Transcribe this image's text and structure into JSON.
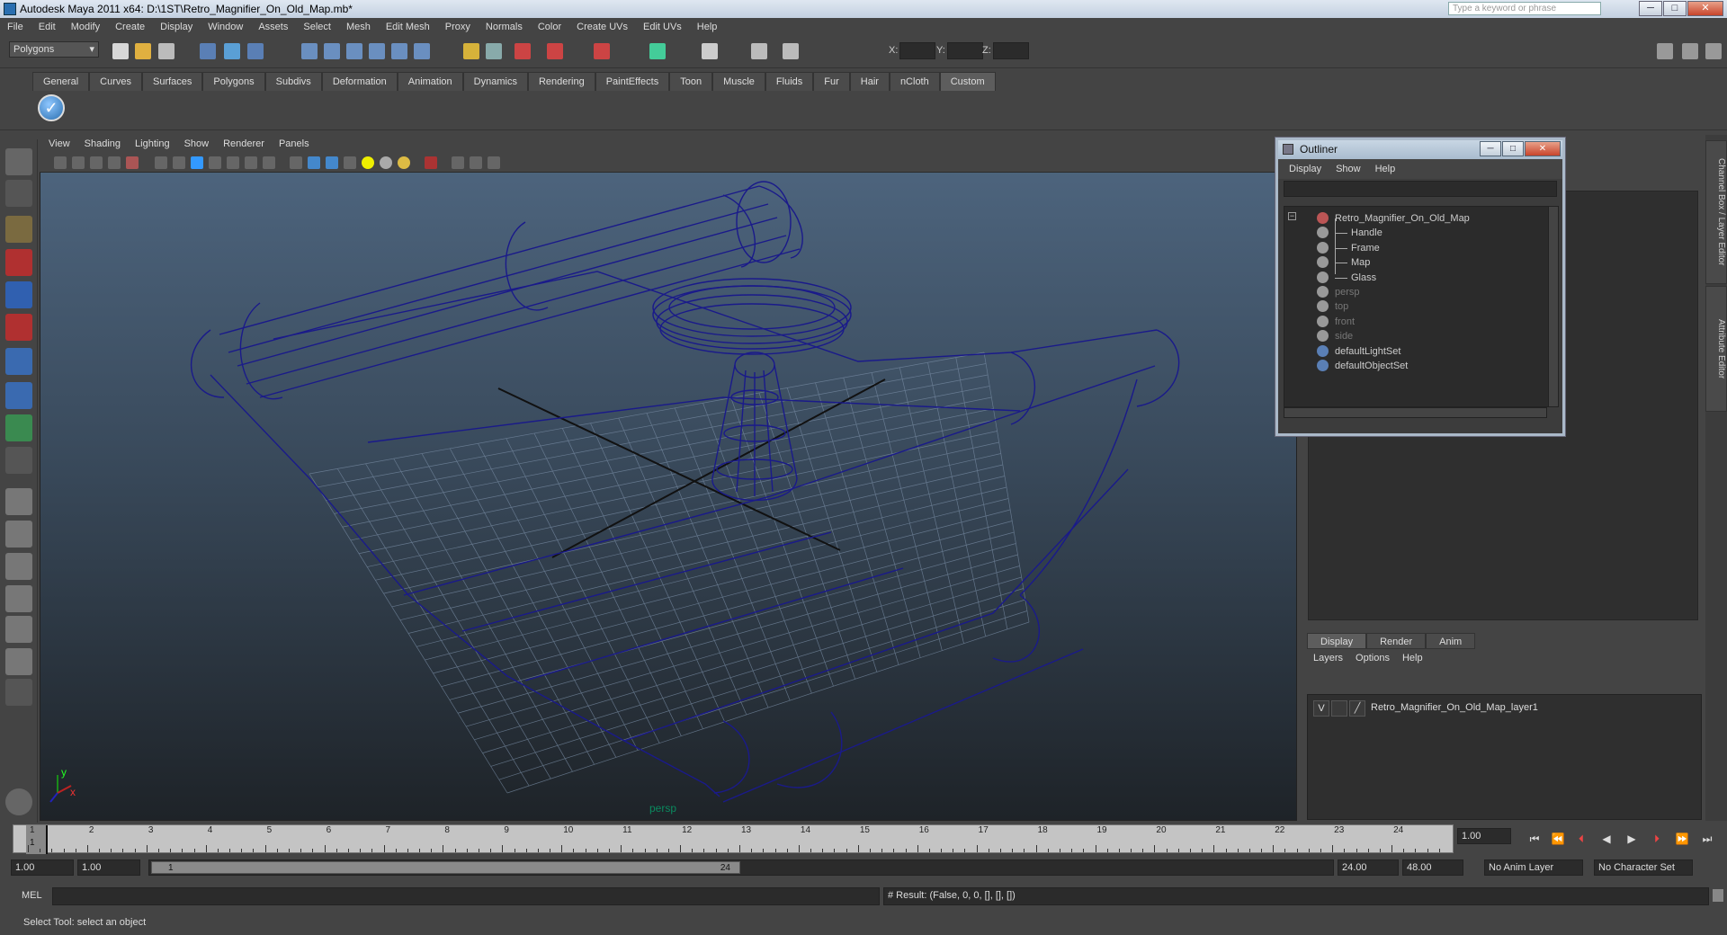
{
  "window": {
    "title": "Autodesk Maya 2011 x64: D:\\1ST\\Retro_Magnifier_On_Old_Map.mb*",
    "search_placeholder": "Type a keyword or phrase",
    "minimize": "─",
    "maximize": "□",
    "close": "✕"
  },
  "menubar": [
    "File",
    "Edit",
    "Modify",
    "Create",
    "Display",
    "Window",
    "Assets",
    "Select",
    "Mesh",
    "Edit Mesh",
    "Proxy",
    "Normals",
    "Color",
    "Create UVs",
    "Edit UVs",
    "Help"
  ],
  "status": {
    "mode": "Polygons",
    "x_label": "X:",
    "y_label": "Y:",
    "z_label": "Z:"
  },
  "shelf_tabs": [
    "General",
    "Curves",
    "Surfaces",
    "Polygons",
    "Subdivs",
    "Deformation",
    "Animation",
    "Dynamics",
    "Rendering",
    "PaintEffects",
    "Toon",
    "Muscle",
    "Fluids",
    "Fur",
    "Hair",
    "nCloth",
    "Custom"
  ],
  "shelf_active": "Custom",
  "viewport": {
    "menu": [
      "View",
      "Shading",
      "Lighting",
      "Show",
      "Renderer",
      "Panels"
    ],
    "camera": "persp",
    "axis_x": "x",
    "axis_y": "y",
    "wire_color": "#1a1a8a",
    "grid_color": "#7a8ea6"
  },
  "outliner": {
    "title": "Outliner",
    "menu": [
      "Display",
      "Show",
      "Help"
    ],
    "rows": [
      {
        "label": "Retro_Magnifier_On_Old_Map",
        "dim": false
      },
      {
        "label": "Handle",
        "dim": false
      },
      {
        "label": "Frame",
        "dim": false
      },
      {
        "label": "Map",
        "dim": false
      },
      {
        "label": "Glass",
        "dim": false
      },
      {
        "label": "persp",
        "dim": true
      },
      {
        "label": "top",
        "dim": true
      },
      {
        "label": "front",
        "dim": true
      },
      {
        "label": "side",
        "dim": true
      },
      {
        "label": "defaultLightSet",
        "dim": false
      },
      {
        "label": "defaultObjectSet",
        "dim": false
      }
    ]
  },
  "right_vtabs": [
    "Channel Box / Layer Editor",
    "Attribute Editor"
  ],
  "layers": {
    "tabs": [
      "Display",
      "Render",
      "Anim"
    ],
    "menu": [
      "Layers",
      "Options",
      "Help"
    ],
    "visible_flag": "V",
    "layer_name": "Retro_Magnifier_On_Old_Map_layer1"
  },
  "timeline": {
    "ticks": [
      "1",
      "2",
      "3",
      "4",
      "5",
      "6",
      "7",
      "8",
      "9",
      "10",
      "11",
      "12",
      "13",
      "14",
      "15",
      "16",
      "17",
      "18",
      "19",
      "20",
      "21",
      "22",
      "23",
      "24"
    ],
    "current_frame": "1",
    "current_field": "1.00"
  },
  "range": {
    "start": "1.00",
    "start2": "1.00",
    "thumb_start": "1",
    "thumb_end": "24",
    "end": "24.00",
    "end2": "48.00",
    "anim_layer": "No Anim Layer",
    "char_set": "No Character Set"
  },
  "cmd": {
    "label": "MEL",
    "result": "# Result: (False, 0, 0, [], [], [])"
  },
  "help": "Select Tool: select an object"
}
